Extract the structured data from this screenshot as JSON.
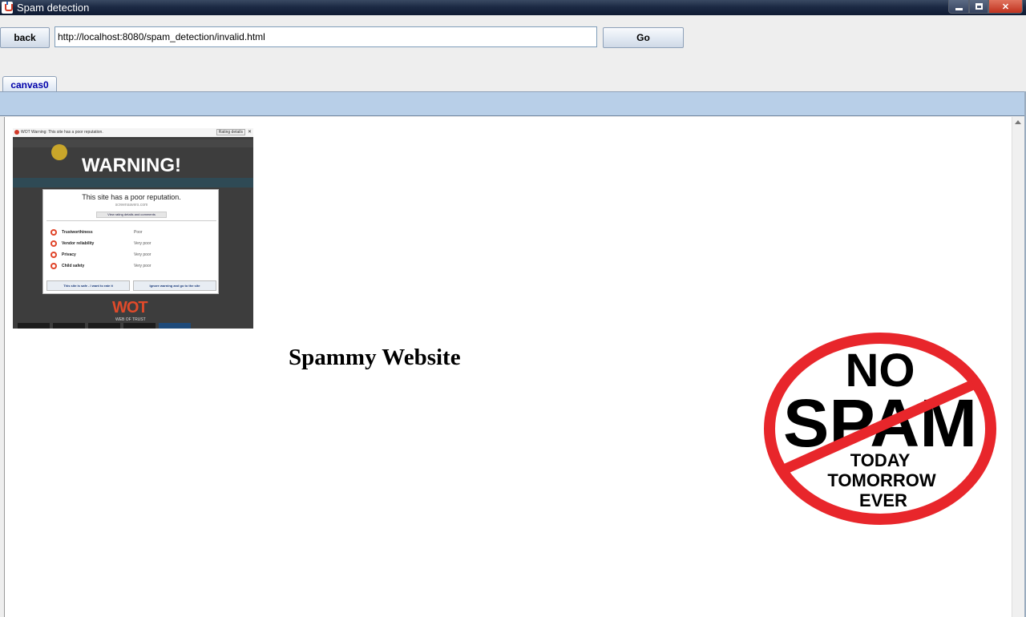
{
  "window": {
    "title": "Spam detection",
    "icon": "java-cup-icon",
    "controls": [
      "minimize",
      "maximize",
      "close"
    ]
  },
  "toolbar": {
    "back_label": "back",
    "url_value": "http://localhost:8080/spam_detection/invalid.html",
    "go_label": "Go"
  },
  "tabs": [
    {
      "label": "canvas0",
      "selected": true
    }
  ],
  "content": {
    "heading": "Spammy Website",
    "warning_image": {
      "topbar_text": "WOT Warning: This site has a poor reputation.",
      "rating_details": "Rating details",
      "banner": "WARNING!",
      "dialog_title": "This site has a poor reputation.",
      "dialog_site": "screensavers.com",
      "dialog_link": "View rating details and comments",
      "ratings": [
        {
          "label": "Trustworthiness",
          "value": "Poor"
        },
        {
          "label": "Vendor reliability",
          "value": "Very poor"
        },
        {
          "label": "Privacy",
          "value": "Very poor"
        },
        {
          "label": "Child safety",
          "value": "Very poor"
        }
      ],
      "button_left": "This site is safe - I want to rate it",
      "button_right": "Ignore warning and go to the site",
      "wot_logo": "WOT",
      "wot_sub": "WEB OF TRUST"
    },
    "no_spam_sign": {
      "line1": "NO",
      "line2": "SPAM",
      "line3": "TODAY",
      "line4": "TOMORROW",
      "line5": "EVER",
      "ring_color": "#e8262b"
    }
  },
  "colors": {
    "tab_text": "#0000aa",
    "tab_strip": "#b8cfe8",
    "titlebar": "#1c2a44"
  }
}
